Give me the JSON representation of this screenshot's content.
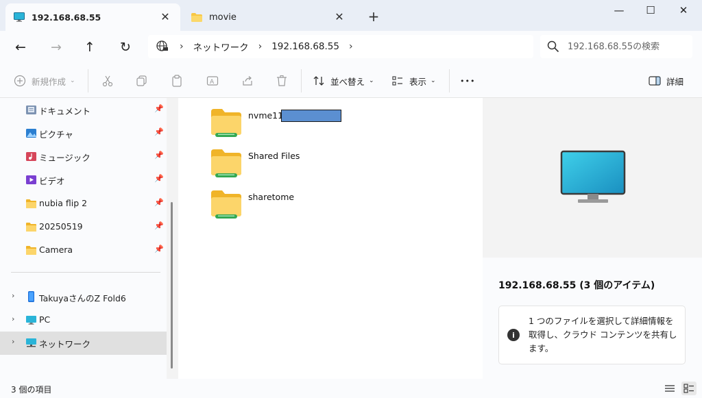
{
  "tabs": [
    {
      "label": "192.168.68.55",
      "icon": "monitor-icon",
      "active": true
    },
    {
      "label": "movie",
      "icon": "folder-icon",
      "active": false
    }
  ],
  "window_controls": {
    "minimize": "—",
    "maximize": "☐",
    "close": "✕"
  },
  "address": {
    "breadcrumbs": [
      "ネットワーク",
      "192.168.68.55"
    ],
    "search_placeholder": "192.168.68.55の検索"
  },
  "toolbar": {
    "new": "新規作成",
    "sort": "並べ替え",
    "view": "表示",
    "more": "•••",
    "details": "詳細"
  },
  "sidebar": {
    "pinned": [
      {
        "label": "ドキュメント",
        "icon": "documents-icon"
      },
      {
        "label": "ピクチャ",
        "icon": "pictures-icon"
      },
      {
        "label": "ミュージック",
        "icon": "music-icon"
      },
      {
        "label": "ビデオ",
        "icon": "videos-icon"
      },
      {
        "label": "nubia flip 2",
        "icon": "folder-icon"
      },
      {
        "label": "20250519",
        "icon": "folder-icon"
      },
      {
        "label": "Camera",
        "icon": "folder-icon"
      }
    ],
    "devices": [
      {
        "label": "TakuyaさんのZ Fold6",
        "icon": "phone-icon",
        "selected": false
      },
      {
        "label": "PC",
        "icon": "pc-icon",
        "selected": false
      },
      {
        "label": "ネットワーク",
        "icon": "network-icon",
        "selected": true
      }
    ]
  },
  "files": [
    {
      "name": "nvme11-",
      "redacted": true
    },
    {
      "name": "Shared Files",
      "redacted": false
    },
    {
      "name": "sharetome",
      "redacted": false
    }
  ],
  "details_pane": {
    "title": "192.168.68.55 (3 個のアイテム)",
    "info": "1 つのファイルを選択して詳細情報を取得し、クラウド コンテンツを共有します。"
  },
  "statusbar": {
    "text": "3 個の項目"
  },
  "colors": {
    "accent": "#0067c0",
    "folder": "#f8c744",
    "share": "#34a853"
  }
}
